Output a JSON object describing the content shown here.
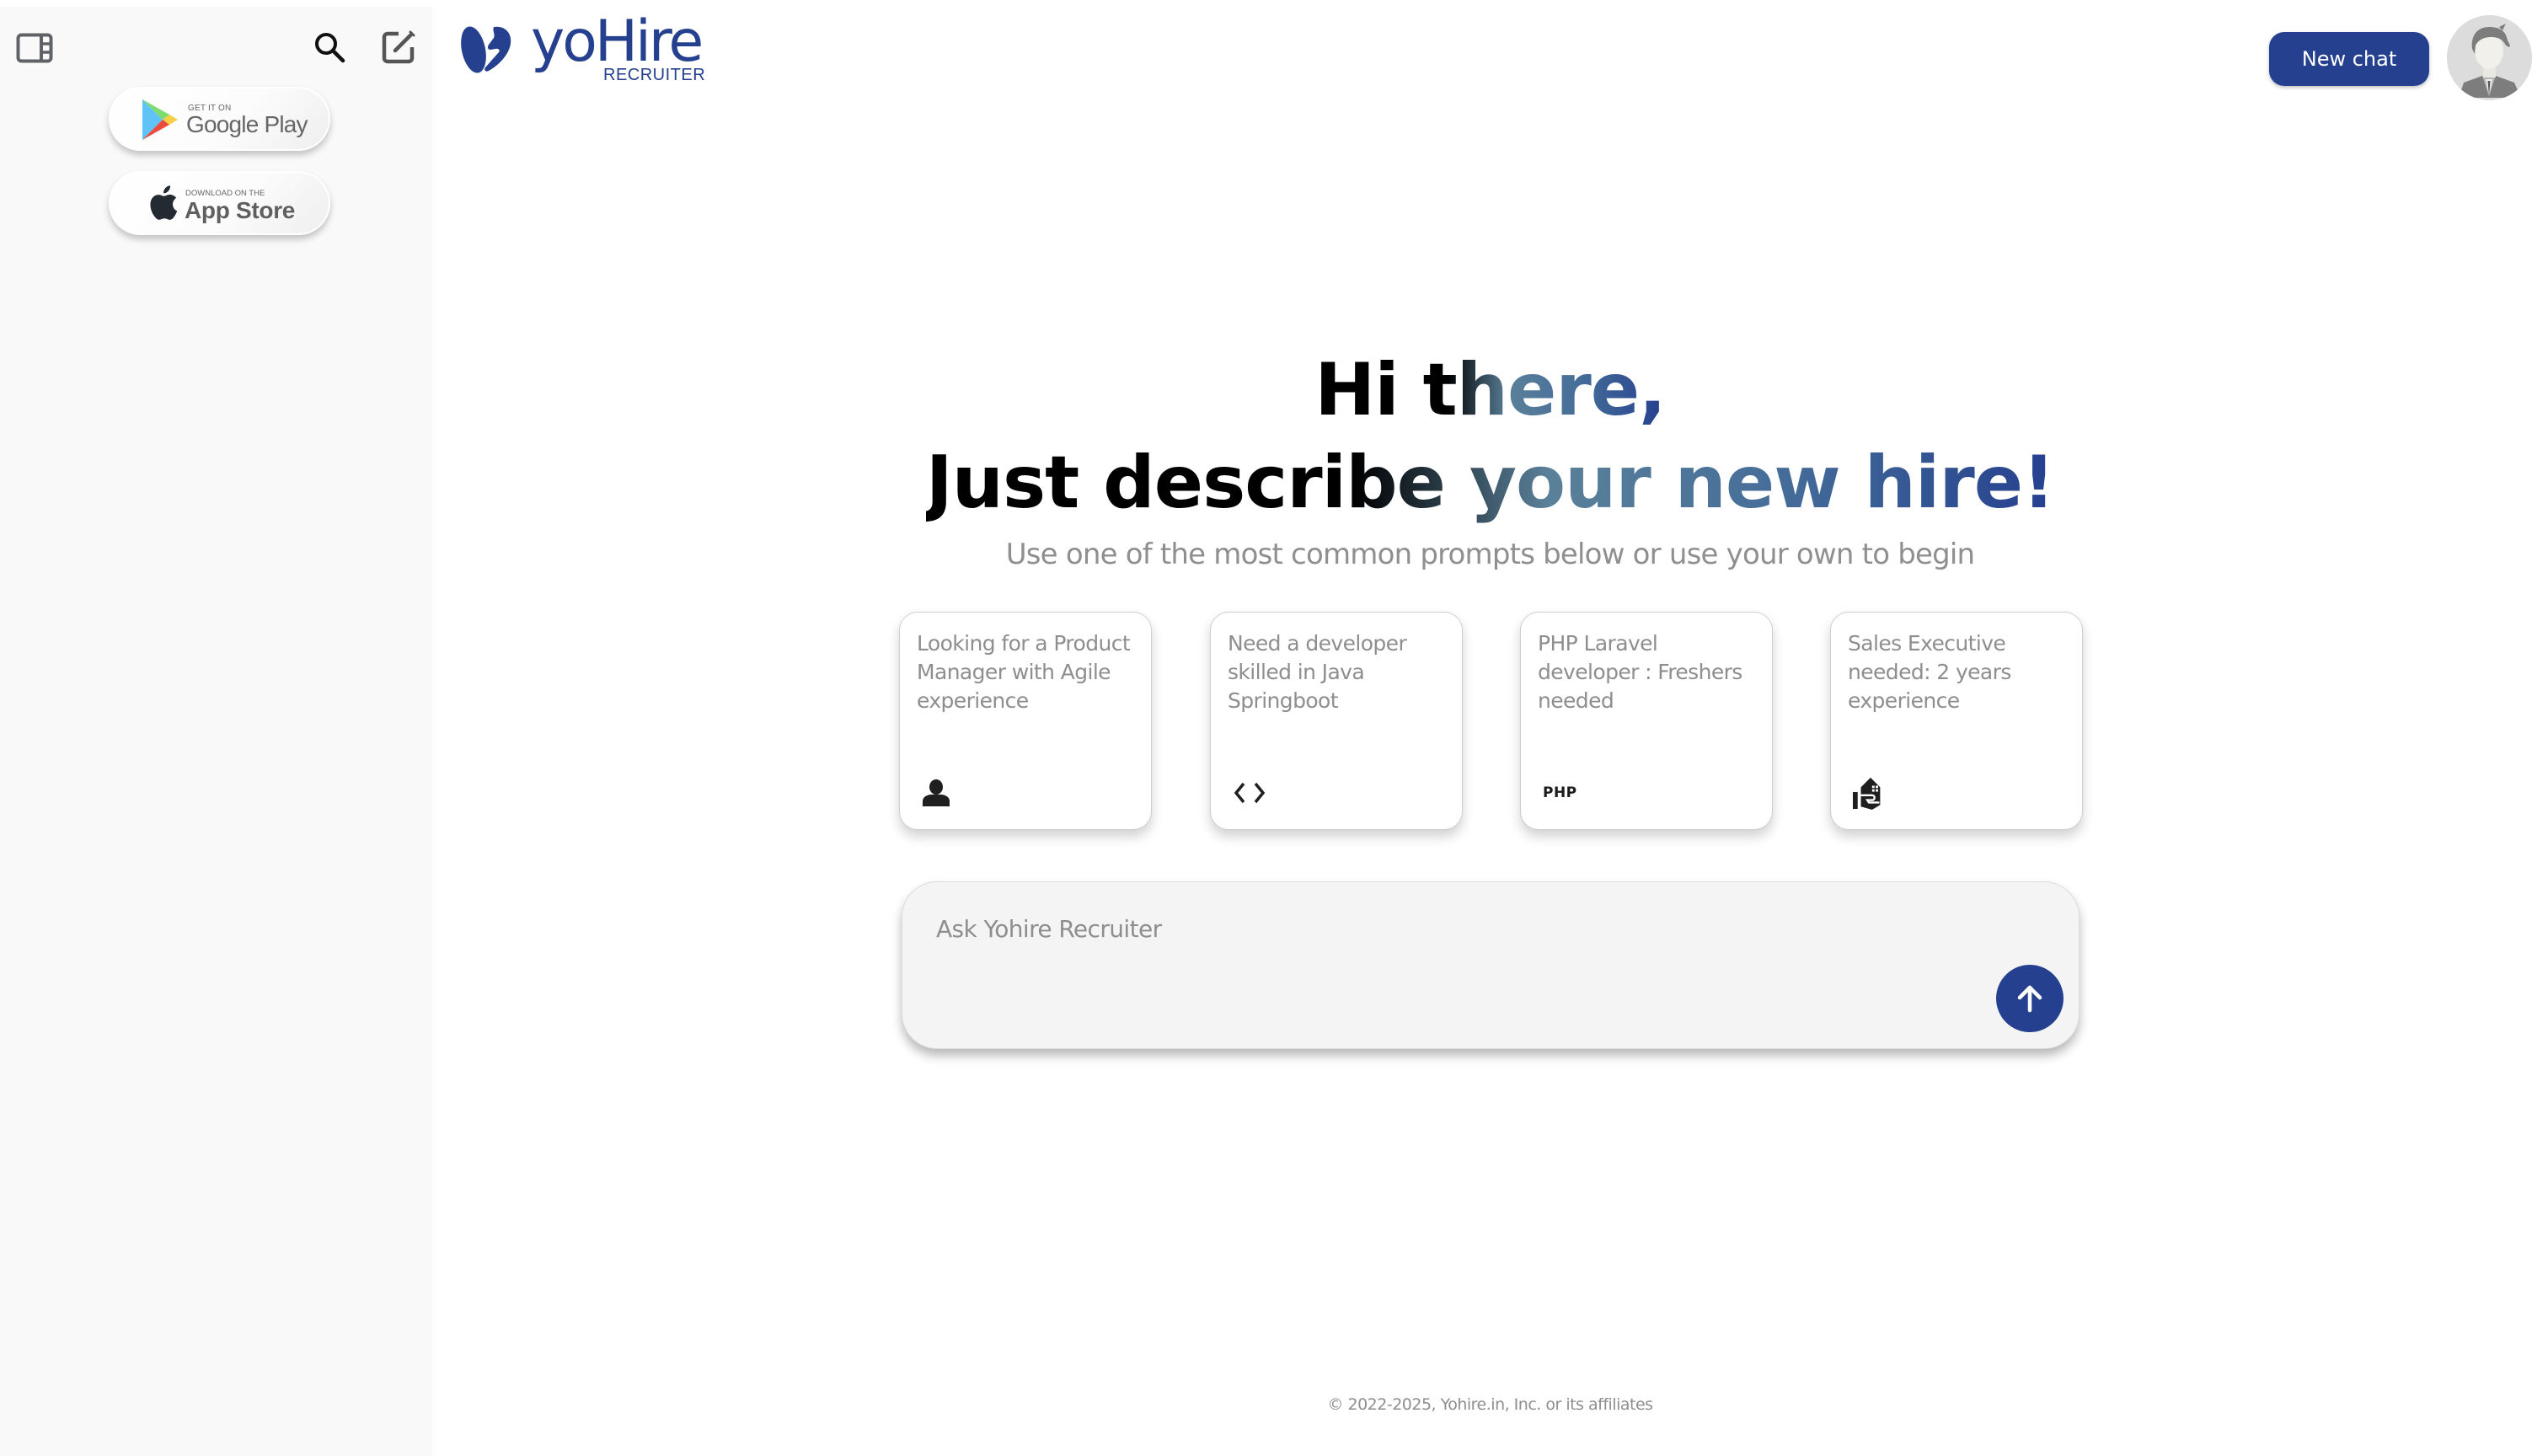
{
  "sidebar": {
    "toggle_icon": "sidebar-panel-icon",
    "search_icon": "search-icon",
    "new_chat_icon": "edit-icon",
    "store_buttons": [
      {
        "small": "GET IT ON",
        "big": "Google Play",
        "icon": "google-play-icon"
      },
      {
        "small": "DOWNLOAD ON THE",
        "big": "App Store",
        "icon": "apple-icon"
      }
    ]
  },
  "header": {
    "brand_name": "yoHire",
    "brand_sub": "RECRUITER",
    "new_chat_label": "New chat",
    "avatar_icon": "user-avatar",
    "brand_color": "#25408f"
  },
  "hero": {
    "line1": "Hi there,",
    "line2": "Just describe your new hire!",
    "subtitle": "Use one of the most common prompts below or use your own to begin"
  },
  "prompts": [
    {
      "text": "Looking for a Product Manager with Agile experience",
      "icon": "person-icon"
    },
    {
      "text": "Need a developer skilled in Java Springboot",
      "icon": "code-icon"
    },
    {
      "text": "PHP Laravel developer : Freshers needed",
      "icon": "php-icon",
      "icon_text": "PHP"
    },
    {
      "text": "Sales Executive needed: 2 years experience",
      "icon": "hand-house-icon"
    }
  ],
  "composer": {
    "placeholder": "Ask Yohire Recruiter",
    "value": "",
    "send_icon": "arrow-up-icon"
  },
  "footer": {
    "copyright": "© 2022-2025, Yohire.in, Inc. or its affiliates"
  }
}
